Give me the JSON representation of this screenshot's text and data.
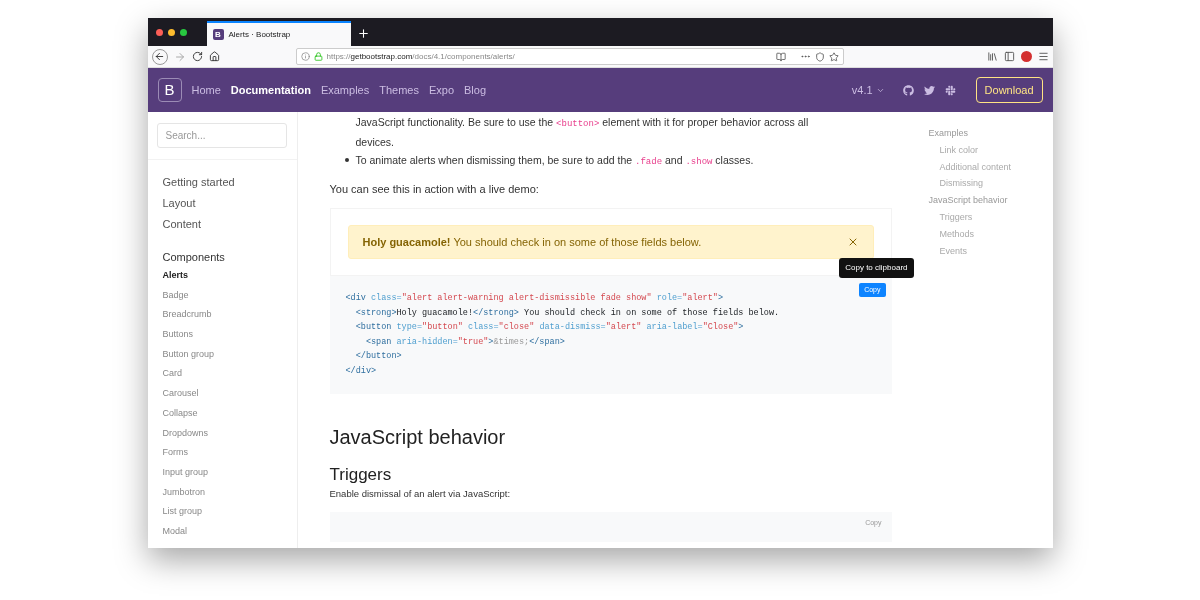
{
  "browser": {
    "tab": {
      "favicon": "B",
      "title": "Alerts · Bootstrap",
      "selected": true
    },
    "url": {
      "scheme": "https://",
      "domain": "getbootstrap.com",
      "path": "/docs/4.1/components/alerts/"
    }
  },
  "navbar": {
    "logo": "B",
    "links": [
      {
        "label": "Home",
        "selected": false
      },
      {
        "label": "Documentation",
        "selected": true
      },
      {
        "label": "Examples",
        "selected": false
      },
      {
        "label": "Themes",
        "selected": false
      },
      {
        "label": "Expo",
        "selected": false
      },
      {
        "label": "Blog",
        "selected": false
      }
    ],
    "version": "v4.1",
    "download": "Download"
  },
  "sidebar": {
    "search": {
      "placeholder": "Search..."
    },
    "sections": [
      {
        "items": [
          {
            "label": "Getting started",
            "selected": false
          },
          {
            "label": "Layout",
            "selected": false
          },
          {
            "label": "Content",
            "selected": false
          }
        ]
      },
      {
        "title": "Components",
        "items": [
          {
            "label": "Alerts",
            "selected": true
          },
          {
            "label": "Badge",
            "selected": false
          },
          {
            "label": "Breadcrumb",
            "selected": false
          },
          {
            "label": "Buttons",
            "selected": false
          },
          {
            "label": "Button group",
            "selected": false
          },
          {
            "label": "Card",
            "selected": false
          },
          {
            "label": "Carousel",
            "selected": false
          },
          {
            "label": "Collapse",
            "selected": false
          },
          {
            "label": "Dropdowns",
            "selected": false
          },
          {
            "label": "Forms",
            "selected": false
          },
          {
            "label": "Input group",
            "selected": false
          },
          {
            "label": "Jumbotron",
            "selected": false
          },
          {
            "label": "List group",
            "selected": false
          },
          {
            "label": "Modal",
            "selected": false
          }
        ]
      }
    ]
  },
  "content": {
    "bullets": [
      {
        "kind": "continuation",
        "parts": [
          {
            "t": "JavaScript functionality. Be sure to use the "
          },
          {
            "code": "<button>"
          },
          {
            "t": " element with it for proper behavior across all devices."
          }
        ]
      },
      {
        "kind": "bullet",
        "parts": [
          {
            "t": "To animate alerts when dismissing them, be sure to add the "
          },
          {
            "code": ".fade"
          },
          {
            "t": " and "
          },
          {
            "code": ".show"
          },
          {
            "t": " classes."
          }
        ]
      }
    ],
    "intro": "You can see this in action with a live demo:",
    "alert": {
      "strong": "Holy guacamole!",
      "text": " You should check in on some of those fields below."
    },
    "code_block": {
      "copy": "Copy",
      "tooltip": "Copy to clipboard",
      "lines": [
        {
          "tokens": [
            {
              "kind": "tag",
              "t": "<div"
            },
            {
              "kind": "attr",
              "t": " class="
            },
            {
              "kind": "string",
              "t": "\"alert alert-warning alert-dismissible fade show\""
            },
            {
              "kind": "attr",
              "t": " role="
            },
            {
              "kind": "string",
              "t": "\"alert\""
            },
            {
              "kind": "tag",
              "t": ">"
            }
          ]
        },
        {
          "tokens": [
            {
              "kind": "tag",
              "t": "  <strong>"
            },
            {
              "kind": "text",
              "t": "Holy guacamole!"
            },
            {
              "kind": "tag",
              "t": "</strong>"
            },
            {
              "kind": "text",
              "t": " You should check in on some of those fields below."
            }
          ]
        },
        {
          "tokens": [
            {
              "kind": "tag",
              "t": "  <button"
            },
            {
              "kind": "attr",
              "t": " type="
            },
            {
              "kind": "string",
              "t": "\"button\""
            },
            {
              "kind": "attr",
              "t": " class="
            },
            {
              "kind": "string",
              "t": "\"close\""
            },
            {
              "kind": "attr",
              "t": " data-dismiss="
            },
            {
              "kind": "string",
              "t": "\"alert\""
            },
            {
              "kind": "attr",
              "t": " aria-label="
            },
            {
              "kind": "string",
              "t": "\"Close\""
            },
            {
              "kind": "tag",
              "t": ">"
            }
          ]
        },
        {
          "tokens": [
            {
              "kind": "tag",
              "t": "    <span"
            },
            {
              "kind": "attr",
              "t": " aria-hidden="
            },
            {
              "kind": "string",
              "t": "\"true\""
            },
            {
              "kind": "tag",
              "t": ">"
            },
            {
              "kind": "entity",
              "t": "&times;"
            },
            {
              "kind": "tag",
              "t": "</span>"
            }
          ]
        },
        {
          "tokens": [
            {
              "kind": "tag",
              "t": "  </button>"
            }
          ]
        },
        {
          "tokens": [
            {
              "kind": "tag",
              "t": "</div>"
            }
          ]
        }
      ]
    },
    "h2": "JavaScript behavior",
    "h3": "Triggers",
    "trigger_text": "Enable dismissal of an alert via JavaScript:",
    "copy2": "Copy"
  },
  "toc": [
    {
      "label": "Examples",
      "children": [
        {
          "label": "Link color"
        },
        {
          "label": "Additional content"
        },
        {
          "label": "Dismissing"
        }
      ]
    },
    {
      "label": "JavaScript behavior",
      "children": [
        {
          "label": "Triggers"
        },
        {
          "label": "Methods"
        },
        {
          "label": "Events"
        }
      ]
    }
  ]
}
